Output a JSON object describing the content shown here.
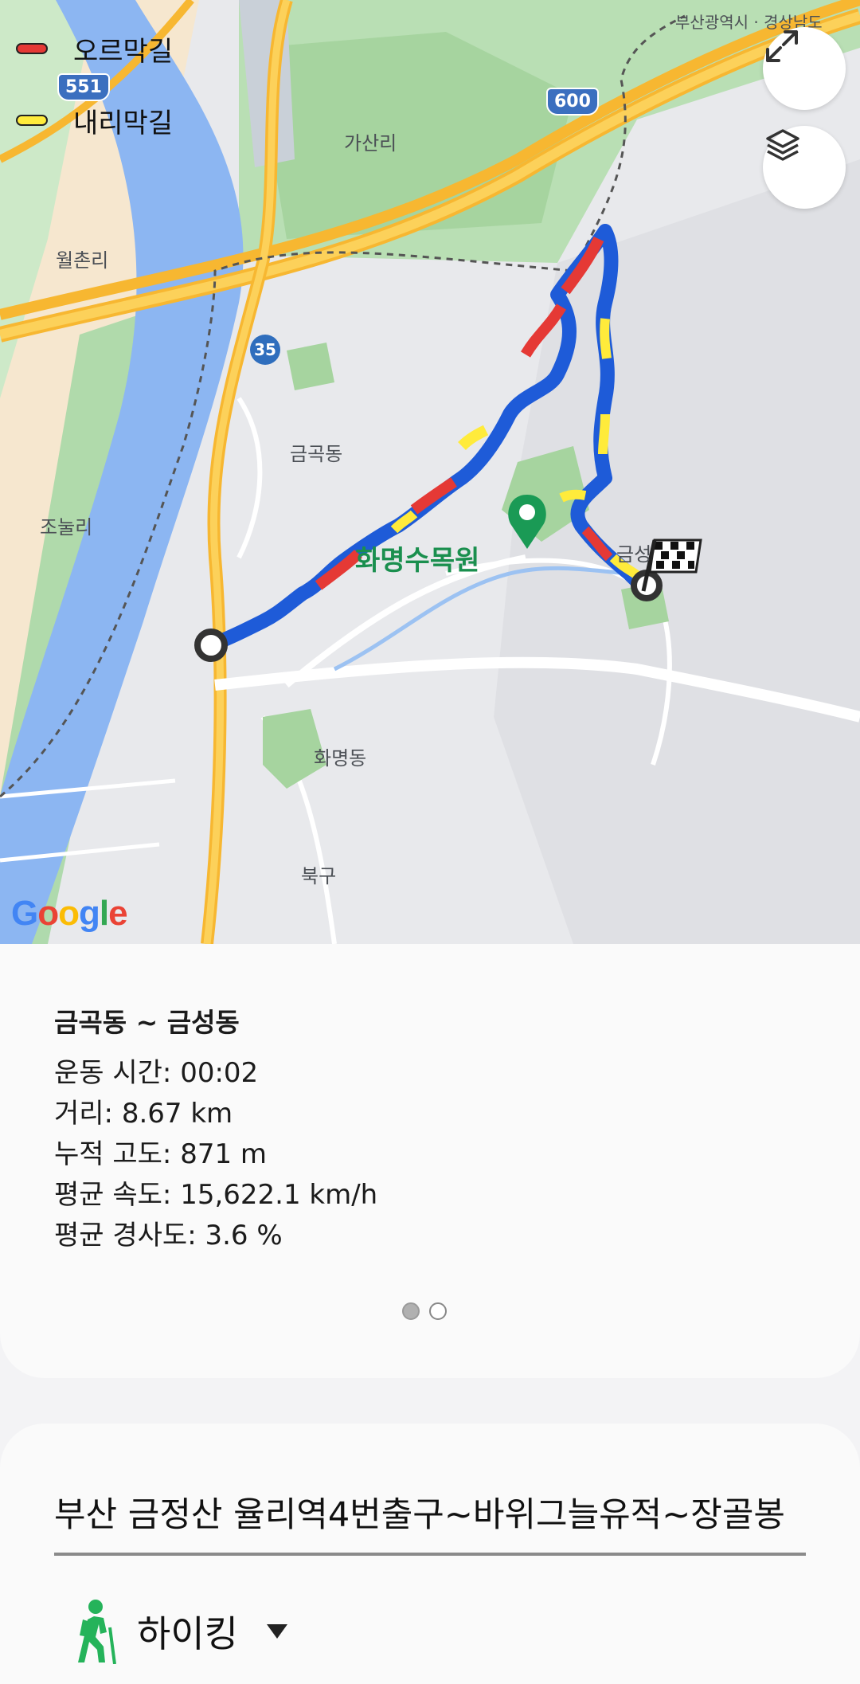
{
  "map": {
    "legend": [
      {
        "label": "오르막길",
        "color": "#e53935"
      },
      {
        "label": "내리막길",
        "color": "#ffeb3b"
      }
    ],
    "labels": {
      "region_top": "부산광역시 · 경상남도",
      "gasan": "가산리",
      "wolchon": "월촌리",
      "geumgok": "금곡동",
      "jonul": "조눌리",
      "hwamyeong": "화명동",
      "bukgu": "북구",
      "geumseong": "금성",
      "poi": "화명수목원"
    },
    "highway_shields": [
      "551",
      "600",
      "35"
    ],
    "attribution": "Google",
    "buttons": {
      "expand": "expand-icon",
      "layers": "layers-icon"
    },
    "route_color": "#1e5bd8"
  },
  "summary": {
    "title": "금곡동 ~ 금성동",
    "duration": "운동 시간: 00:02",
    "distance": "거리: 8.67 km",
    "elevation": "누적 고도: 871 m",
    "avg_speed": "평균 속도: 15,622.1 km/h",
    "avg_slope": "평균 경사도: 3.6 %",
    "page_index": 1,
    "page_count": 2
  },
  "workout": {
    "name": "부산 금정산 율리역4번출구~바위그늘유적~장골봉",
    "activity": "하이킹"
  }
}
